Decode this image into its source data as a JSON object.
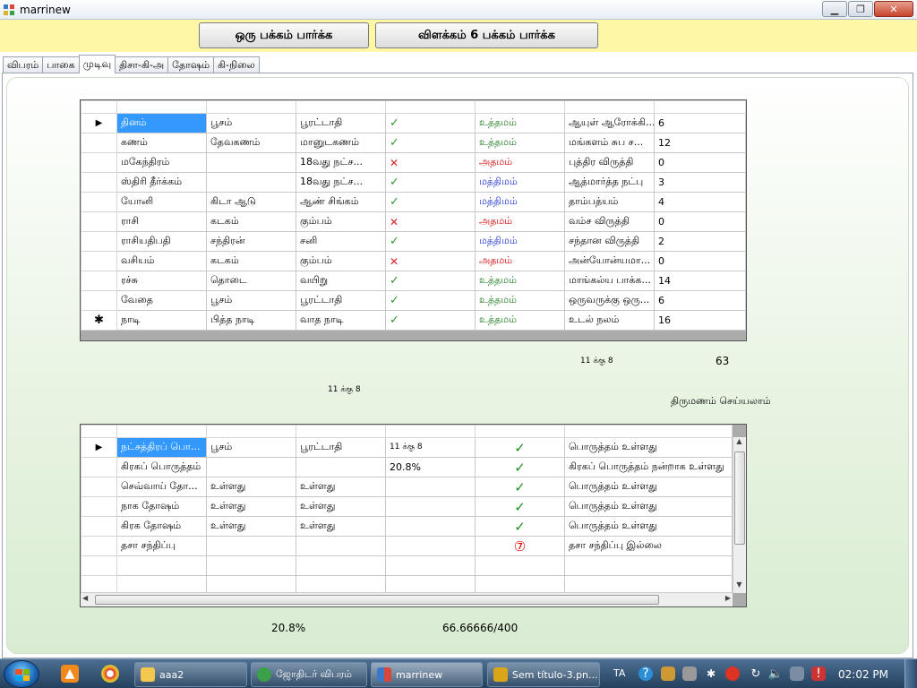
{
  "window": {
    "title": "marrinew"
  },
  "top_buttons": {
    "one_page": "ஒரு பக்கம் பார்க்க",
    "explain_6": "விளக்கம் 6 பக்கம் பார்க்க"
  },
  "tabs": [
    "விபரம்",
    "பாகை",
    "முடிவு",
    "திசா-கி-அ",
    "தோஷம்",
    "கி-நிலை"
  ],
  "grid1": {
    "rows": [
      {
        "name": "தினம்",
        "boy": "பூசம்",
        "girl": "பூரட்டாதி",
        "mark": "tick",
        "quality": "உத்தமம்",
        "q": "good",
        "desc": "ஆயுள் ஆரோக்கி...",
        "score": "6"
      },
      {
        "name": "கணம்",
        "boy": "தேவகணம்",
        "girl": "மானுடகணம்",
        "mark": "tick",
        "quality": "உத்தமம்",
        "q": "good",
        "desc": "மங்களம் சுப ச...",
        "score": "12"
      },
      {
        "name": "மகேந்திரம்",
        "boy": "",
        "girl": "18வது நட்ச...",
        "mark": "cross",
        "quality": "அதமம்",
        "q": "bad",
        "desc": "புத்திர விருத்தி",
        "score": "0"
      },
      {
        "name": "ஸ்திரி தீர்க்கம்",
        "boy": "",
        "girl": "18வது நட்ச...",
        "mark": "tick",
        "quality": "மத்திமம்",
        "q": "mid",
        "desc": "ஆத்மார்த்த நட்பு",
        "score": "3"
      },
      {
        "name": "யோனி",
        "boy": "கிடா ஆடு",
        "girl": "ஆண் சிங்கம்",
        "mark": "tick",
        "quality": "மத்திமம்",
        "q": "mid",
        "desc": "தாம்பத்யம்",
        "score": "4"
      },
      {
        "name": "ராசி",
        "boy": "கடகம்",
        "girl": "கும்பம்",
        "mark": "cross",
        "quality": "அதமம்",
        "q": "bad",
        "desc": "வம்ச விருத்தி",
        "score": "0"
      },
      {
        "name": "ராசியதிபதி",
        "boy": "சந்திரன்",
        "girl": "சனி",
        "mark": "tick",
        "quality": "மத்திமம்",
        "q": "mid",
        "desc": "சந்தான விருத்தி",
        "score": "2"
      },
      {
        "name": "வசியம்",
        "boy": "கடகம்",
        "girl": "கும்பம்",
        "mark": "cross",
        "quality": "அதமம்",
        "q": "bad",
        "desc": "அன்யோன்யமா...",
        "score": "0"
      },
      {
        "name": "ரச்சு",
        "boy": "தொடை",
        "girl": "வயிறு",
        "mark": "tick",
        "quality": "உத்தமம்",
        "q": "good",
        "desc": "மாங்கல்ய பாக்க...",
        "score": "14"
      },
      {
        "name": "வேதை",
        "boy": "பூசம்",
        "girl": "பூரட்டாதி",
        "mark": "tick",
        "quality": "உத்தமம்",
        "q": "good",
        "desc": "ஒருவருக்கு ஒரு...",
        "score": "6"
      },
      {
        "name": "நாடி",
        "boy": "பித்த நாடி",
        "girl": "வாத நாடி",
        "mark": "tick",
        "quality": "உத்தமம்",
        "q": "good",
        "desc": "உடல் நலம்",
        "score": "16"
      }
    ]
  },
  "summary": {
    "ratio_right": "11 க்கு 8",
    "total": "63",
    "ratio_left": "11 க்கு 8",
    "verdict": "திருமணம் செய்யலாம்"
  },
  "grid2": {
    "rows": [
      {
        "name": "நட்சத்திரப் பொ...",
        "boy": "பூசம்",
        "girl": "பூரட்டாதி",
        "val": "11 க்கு 8",
        "mark": "tick",
        "desc": "பொருத்தம் உள்ளது"
      },
      {
        "name": "கிரகப் பொருத்தம்",
        "boy": "",
        "girl": "",
        "val": "20.8%",
        "mark": "tick",
        "desc": "கிரகப் பொருத்தம் நன்றாக உள்ளது"
      },
      {
        "name": "செவ்வாய் தோ...",
        "boy": "உள்ளது",
        "girl": "உள்ளது",
        "val": "",
        "mark": "tick",
        "desc": "பொருத்தம் உள்ளது"
      },
      {
        "name": "நாக தோஷம்",
        "boy": "உள்ளது",
        "girl": "உள்ளது",
        "val": "",
        "mark": "tick",
        "desc": "பொருத்தம் உள்ளது"
      },
      {
        "name": "கிரக தோஷம்",
        "boy": "உள்ளது",
        "girl": "உள்ளது",
        "val": "",
        "mark": "tick",
        "desc": "பொருத்தம் உள்ளது"
      },
      {
        "name": "தசா சந்திப்பு",
        "boy": "",
        "girl": "",
        "val": "",
        "mark": "seven",
        "desc": "தசா சந்திப்பு இல்லை"
      }
    ],
    "seven_glyph": "⑦"
  },
  "bottom": {
    "percent": "20.8%",
    "fraction": "66.66666/400"
  },
  "taskbar": {
    "tasks": [
      "aaa2",
      "ஜோதிடர் விபரம்",
      "marrinew",
      "Sem título-3.pn..."
    ],
    "lang": "TA",
    "clock": "02:02 PM"
  },
  "glyphs": {
    "tick": "✓",
    "cross": "✕",
    "row_pointer": "▶",
    "new_row": "✱"
  }
}
